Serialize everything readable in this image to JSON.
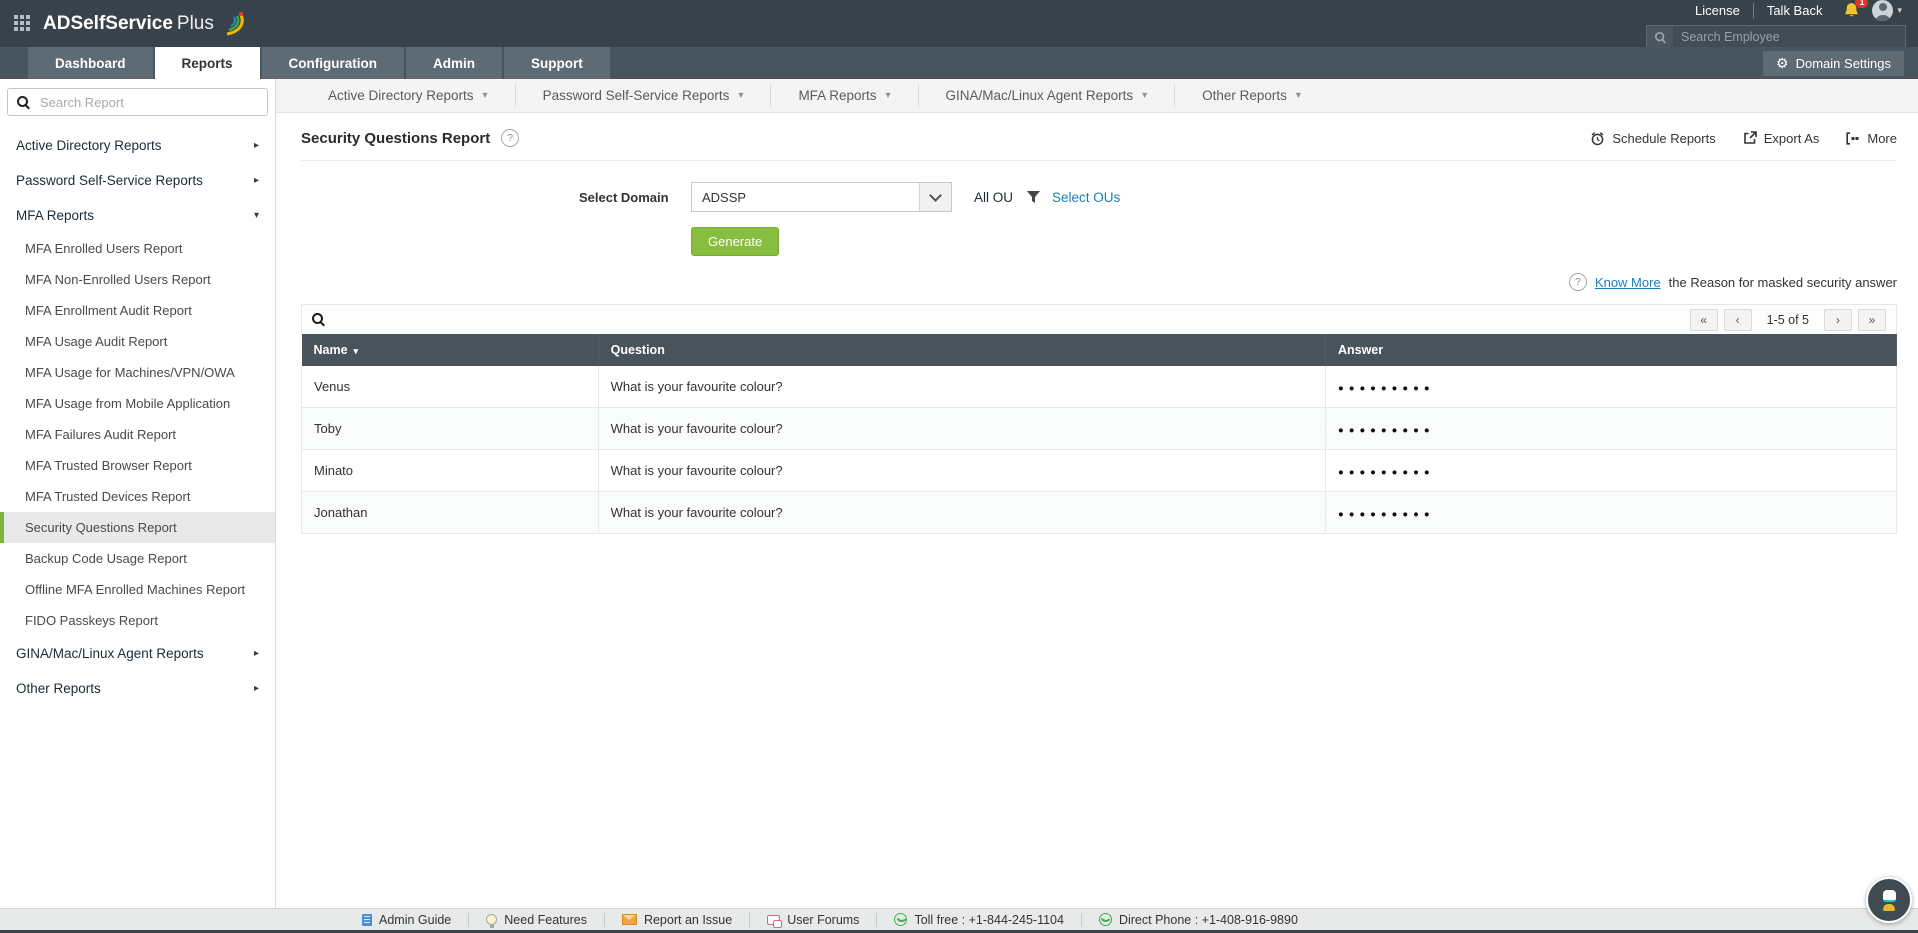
{
  "icons": {
    "gear": "⚙",
    "caret_down": "▾",
    "caret_right": "▸"
  },
  "header": {
    "brand_bold": "ADSelfService",
    "brand_light": "Plus",
    "license_label": "License",
    "talkback_label": "Talk Back",
    "notification_count": "1",
    "search_placeholder": "Search Employee",
    "domain_settings_label": "Domain Settings"
  },
  "tabs": [
    {
      "label": "Dashboard",
      "cls": ""
    },
    {
      "label": "Reports",
      "cls": "active"
    },
    {
      "label": "Configuration",
      "cls": ""
    },
    {
      "label": "Admin",
      "cls": ""
    },
    {
      "label": "Support",
      "cls": ""
    }
  ],
  "category_nav": [
    {
      "label": "Active Directory Reports"
    },
    {
      "label": "Password Self-Service Reports"
    },
    {
      "label": "MFA Reports"
    },
    {
      "label": "GINA/Mac/Linux Agent Reports"
    },
    {
      "label": "Other Reports"
    }
  ],
  "sidebar": {
    "search_placeholder": "Search Report",
    "items": [
      {
        "label": "Active Directory Reports",
        "cls": "top",
        "arrow": "▸"
      },
      {
        "label": "Password Self-Service Reports",
        "cls": "top",
        "arrow": "▸"
      },
      {
        "label": "MFA Reports",
        "cls": "top",
        "arrow": "▾"
      },
      {
        "label": "MFA Enrolled Users Report",
        "cls": "sub",
        "arrow": ""
      },
      {
        "label": "MFA Non-Enrolled Users Report",
        "cls": "sub",
        "arrow": ""
      },
      {
        "label": "MFA Enrollment Audit Report",
        "cls": "sub",
        "arrow": ""
      },
      {
        "label": "MFA Usage Audit Report",
        "cls": "sub",
        "arrow": ""
      },
      {
        "label": "MFA Usage for Machines/VPN/OWA",
        "cls": "sub",
        "arrow": ""
      },
      {
        "label": "MFA Usage from Mobile Application",
        "cls": "sub",
        "arrow": ""
      },
      {
        "label": "MFA Failures Audit Report",
        "cls": "sub",
        "arrow": ""
      },
      {
        "label": "MFA Trusted Browser Report",
        "cls": "sub",
        "arrow": ""
      },
      {
        "label": "MFA Trusted Devices Report",
        "cls": "sub",
        "arrow": ""
      },
      {
        "label": "Security Questions Report",
        "cls": "sub selected",
        "arrow": ""
      },
      {
        "label": "Backup Code Usage Report",
        "cls": "sub",
        "arrow": ""
      },
      {
        "label": "Offline MFA Enrolled Machines Report",
        "cls": "sub",
        "arrow": ""
      },
      {
        "label": "FIDO Passkeys Report",
        "cls": "sub",
        "arrow": ""
      },
      {
        "label": "GINA/Mac/Linux Agent Reports",
        "cls": "top",
        "arrow": "▸"
      },
      {
        "label": "Other Reports",
        "cls": "top",
        "arrow": "▸"
      }
    ]
  },
  "report": {
    "title": "Security Questions Report",
    "help_glyph": "?",
    "actions": {
      "schedule": "Schedule Reports",
      "export": "Export As",
      "more": "More"
    },
    "form": {
      "domain_label": "Select Domain",
      "domain_value": "ADSSP",
      "all_ou_label": "All OU",
      "select_ous_label": "Select OUs",
      "generate_label": "Generate"
    },
    "know_more": {
      "help_glyph": "?",
      "link_text": "Know More",
      "rest_text": "the Reason for masked security answer"
    }
  },
  "table": {
    "pagination": {
      "first": "«",
      "prev": "‹",
      "range_label": "1-5 of 5",
      "next": "›",
      "last": "»"
    },
    "columns": {
      "name": "Name",
      "question": "Question",
      "answer": "Answer"
    },
    "rows": [
      {
        "name": "Venus",
        "question": "What is your favourite colour?",
        "answer": "●●●●●●●●●"
      },
      {
        "name": "Toby",
        "question": "What is your favourite colour?",
        "answer": "●●●●●●●●●"
      },
      {
        "name": "Minato",
        "question": "What is your favourite colour?",
        "answer": "●●●●●●●●●"
      },
      {
        "name": "Jonathan",
        "question": "What is your favourite colour?",
        "answer": "●●●●●●●●●"
      }
    ]
  },
  "footer": {
    "items": [
      {
        "icon": "book",
        "label": "Admin Guide"
      },
      {
        "icon": "bulb",
        "label": "Need Features"
      },
      {
        "icon": "mail",
        "label": "Report an Issue"
      },
      {
        "icon": "chat",
        "label": "User Forums"
      },
      {
        "icon": "phone",
        "label": "Toll free : +1-844-245-1104"
      },
      {
        "icon": "phone",
        "label": "Direct Phone : +1-408-916-9890"
      }
    ]
  },
  "colors": {
    "header_dark": "#37424a",
    "tab_strip": "#49555e",
    "accent_green": "#87be3f",
    "link_blue": "#1d7db6",
    "table_header": "#48535b",
    "selected_border_green": "#7cb43c"
  }
}
